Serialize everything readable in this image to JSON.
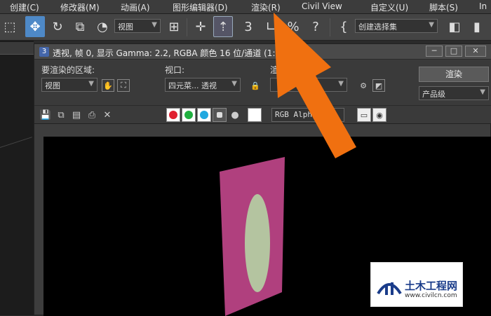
{
  "menu": {
    "items": [
      {
        "label": "创建(C)"
      },
      {
        "label": "修改器(M)"
      },
      {
        "label": "动画(A)"
      },
      {
        "label": "图形编辑器(D)"
      },
      {
        "label": "渲染(R)"
      },
      {
        "label": "Civil View"
      },
      {
        "label": "自定义(U)"
      },
      {
        "label": "脚本(S)"
      },
      {
        "label": "In"
      }
    ]
  },
  "toolbar": {
    "viewport_dropdown": "视图",
    "selection_set_dropdown": "创建选择集"
  },
  "render_window": {
    "title": "透视, 帧 0, 显示 Gamma: 2.2, RGBA 颜色 16 位/通道 (1:1)",
    "area_label": "要渲染的区域:",
    "area_value": "视图",
    "viewport_label": "视口:",
    "viewport_value": "四元菜... 透视",
    "preset_label": "渲染",
    "render_button": "渲染",
    "quality_value": "产品级",
    "channel_value": "RGB Alpha"
  },
  "watermark": {
    "name": "土木工程网",
    "url": "www.civilcn.com"
  },
  "colors": {
    "plane": "#b0407e",
    "ellipse": "#b4c4a0",
    "arrow": "#f07010",
    "accent": "#4e89c7"
  }
}
